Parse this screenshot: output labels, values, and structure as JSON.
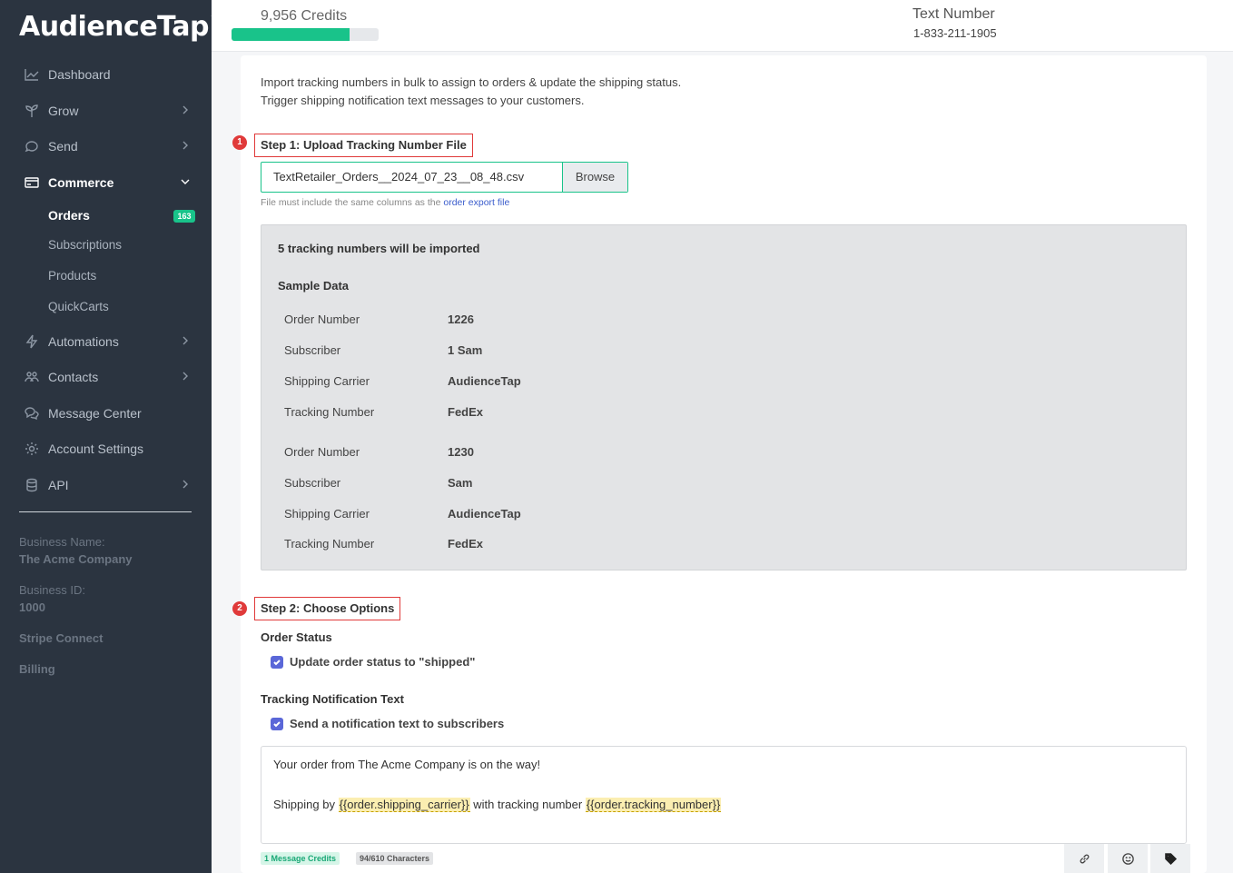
{
  "brand": {
    "name": "AudienceTap",
    "accent": "#19c38a",
    "sidebar_bg": "#2b3440",
    "step_marker": "#e03a3a"
  },
  "topbar": {
    "credits_text": "9,956 Credits",
    "credits_fill_fraction": 0.8,
    "text_number_label": "Text Number",
    "text_number_value": "1-833-211-1905"
  },
  "sidebar": {
    "items": [
      {
        "label": "Dashboard",
        "icon": "chart-icon"
      },
      {
        "label": "Grow",
        "icon": "sprout-icon"
      },
      {
        "label": "Send",
        "icon": "send-icon"
      },
      {
        "label": "Commerce",
        "icon": "credit-card-icon"
      },
      {
        "label": "Automations",
        "icon": "bolt-icon"
      },
      {
        "label": "Contacts",
        "icon": "users-icon"
      },
      {
        "label": "Message Center",
        "icon": "chat-icon"
      },
      {
        "label": "Account Settings",
        "icon": "gear-icon"
      },
      {
        "label": "API",
        "icon": "database-icon"
      }
    ],
    "commerce_sub": [
      "Orders",
      "Subscriptions",
      "Products",
      "QuickCarts"
    ],
    "orders_badge": "163",
    "business_name_label": "Business Name:",
    "business_name": "The Acme Company",
    "business_id_label": "Business ID:",
    "business_id": "1000",
    "stripe_connect": "Stripe Connect",
    "billing": "Billing"
  },
  "main": {
    "intro_line1": "Import tracking numbers in bulk to assign to orders & update the shipping status.",
    "intro_line2": "Trigger shipping notification text messages to your customers.",
    "step1_num": "1",
    "step1_title": "Step 1: Upload Tracking Number File",
    "file_name": "TextRetailer_Orders__2024_07_23__08_48.csv",
    "browse_label": "Browse",
    "hint_text": "File must include the same columns as the",
    "hint_link": "order export file",
    "sample_title": "5 tracking numbers will be imported",
    "sample_subtitle": "Sample Data",
    "records": [
      [
        {
          "label": "Order Number",
          "value": "1226"
        },
        {
          "label": "Subscriber",
          "value": "1 Sam"
        },
        {
          "label": "Shipping Carrier",
          "value": "AudienceTap"
        },
        {
          "label": "Tracking Number",
          "value": "FedEx"
        }
      ],
      [
        {
          "label": "Order Number",
          "value": "1230"
        },
        {
          "label": "Subscriber",
          "value": "Sam"
        },
        {
          "label": "Shipping Carrier",
          "value": "AudienceTap"
        },
        {
          "label": "Tracking Number",
          "value": "FedEx"
        }
      ]
    ],
    "step2_num": "2",
    "step2_title": "Step 2: Choose Options",
    "order_status_head": "Order Status",
    "order_status_check": "Update order status to \"shipped\"",
    "tracking_head": "Tracking Notification Text",
    "tracking_check": "Send a notification text to subscribers",
    "message_line1": "Your order from The Acme Company is on the way!",
    "message_pre": "Shipping by ",
    "message_tag1": "{{order.shipping_carrier}}",
    "message_mid": " with tracking number ",
    "message_tag2": "{{order.tracking_number}}",
    "credits_pill": "1 Message Credits",
    "chars_pill": "94/610 Characters",
    "tools": [
      "link-icon",
      "smiley-icon",
      "tag-icon"
    ]
  }
}
